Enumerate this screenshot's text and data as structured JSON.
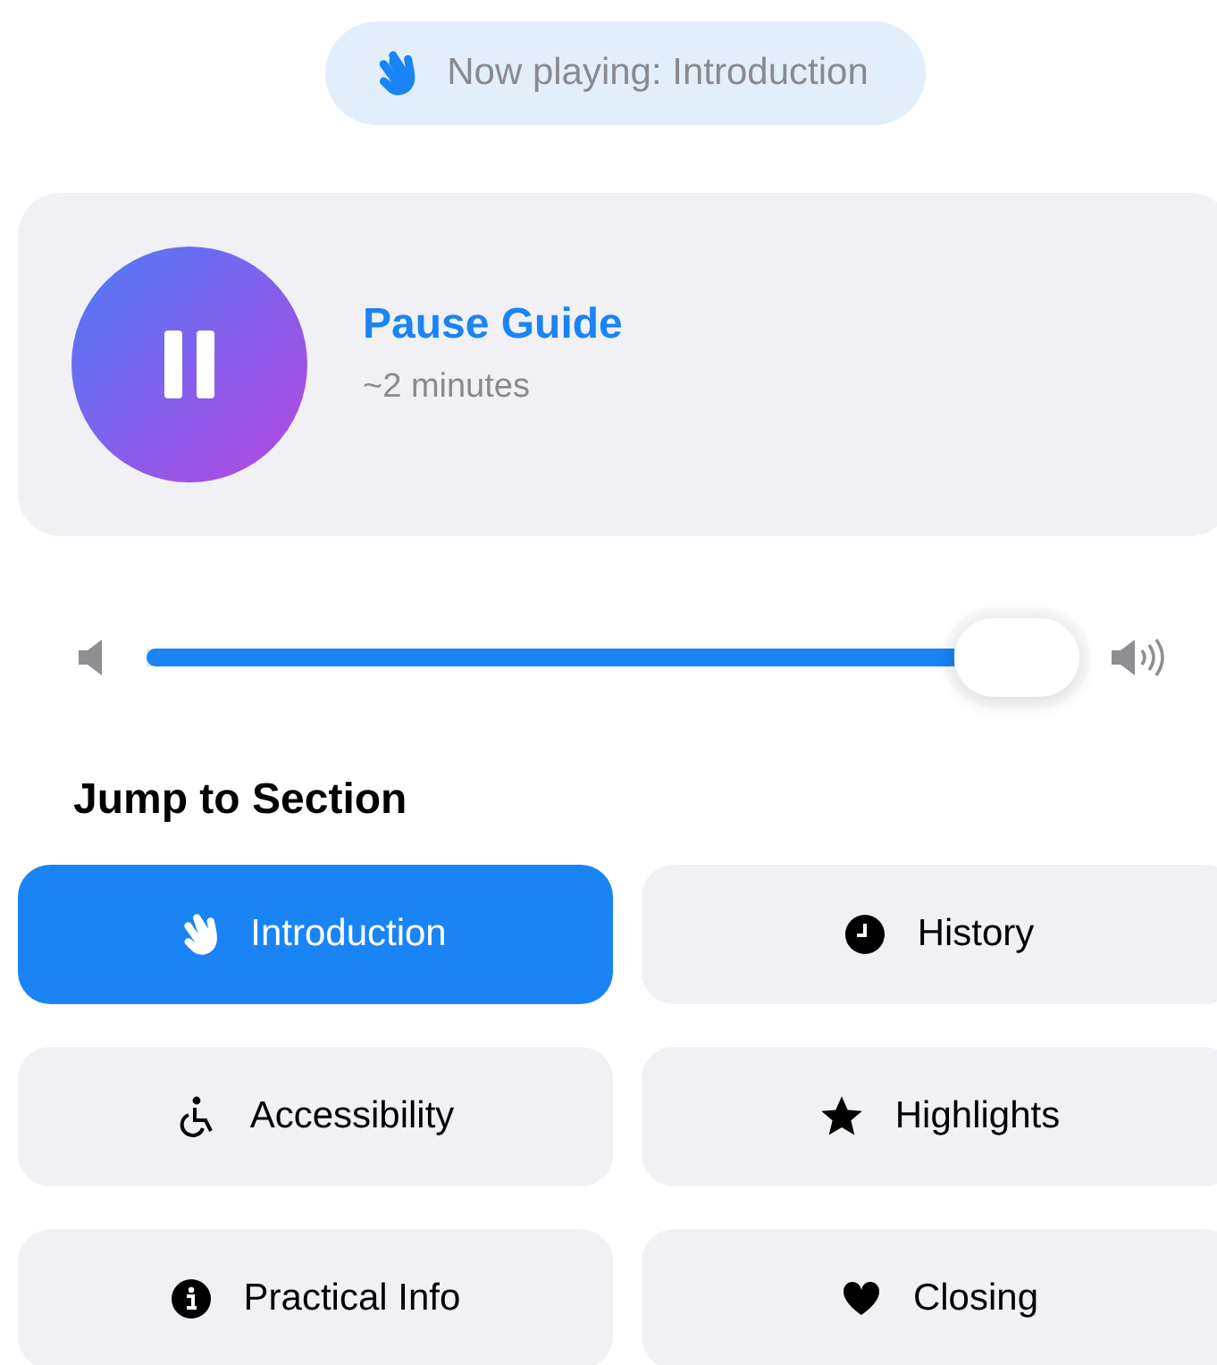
{
  "now_playing": {
    "label": "Now playing: Introduction"
  },
  "player": {
    "title": "Pause Guide",
    "duration": "~2 minutes",
    "playing": true
  },
  "volume": {
    "level": 0.94
  },
  "sections_heading": "Jump to Section",
  "sections": [
    {
      "label": "Introduction",
      "kind": "hand",
      "selected": true
    },
    {
      "label": "History",
      "kind": "clock",
      "selected": false
    },
    {
      "label": "Accessibility",
      "kind": "wheelchair",
      "selected": false
    },
    {
      "label": "Highlights",
      "kind": "star",
      "selected": false
    },
    {
      "label": "Practical Info",
      "kind": "info",
      "selected": false
    },
    {
      "label": "Closing",
      "kind": "heart",
      "selected": false
    }
  ]
}
